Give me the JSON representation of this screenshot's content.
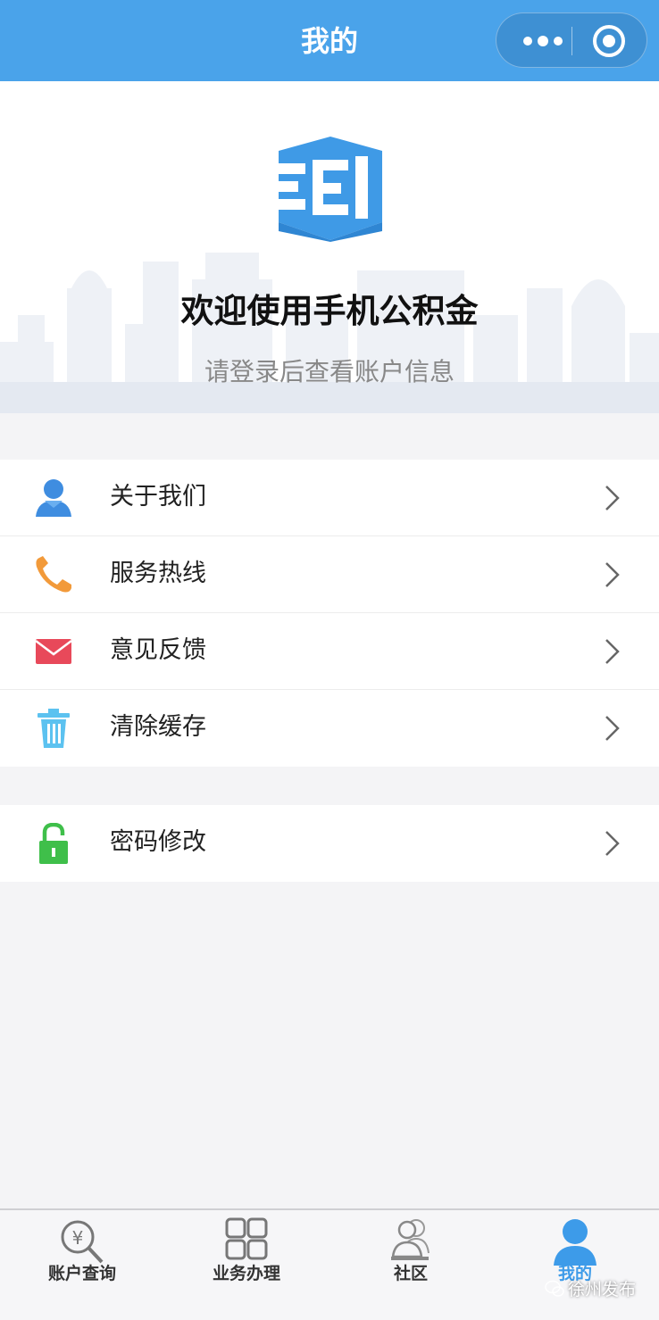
{
  "navbar": {
    "title": "我的"
  },
  "header": {
    "welcome": "欢迎使用手机公积金",
    "subtitle": "请登录后查看账户信息"
  },
  "menu": {
    "group1": [
      {
        "label": "关于我们",
        "icon": "user-icon",
        "color": "#3f8de0"
      },
      {
        "label": "服务热线",
        "icon": "phone-icon",
        "color": "#f29a3a"
      },
      {
        "label": "意见反馈",
        "icon": "mail-icon",
        "color": "#e8495a"
      },
      {
        "label": "清除缓存",
        "icon": "trash-icon",
        "color": "#5cc2f0"
      }
    ],
    "group2": [
      {
        "label": "密码修改",
        "icon": "lock-icon",
        "color": "#3fbf4a"
      }
    ]
  },
  "tabbar": {
    "tabs": [
      {
        "label": "账户查询",
        "icon": "yen-search-icon"
      },
      {
        "label": "业务办理",
        "icon": "grid-icon"
      },
      {
        "label": "社区",
        "icon": "community-icon"
      },
      {
        "label": "我的",
        "icon": "profile-icon",
        "active": true
      }
    ]
  },
  "watermark": {
    "text": "徐州发布"
  },
  "colors": {
    "accent": "#4aa3ea",
    "active_tab": "#3d9be9",
    "background": "#f4f4f6"
  }
}
